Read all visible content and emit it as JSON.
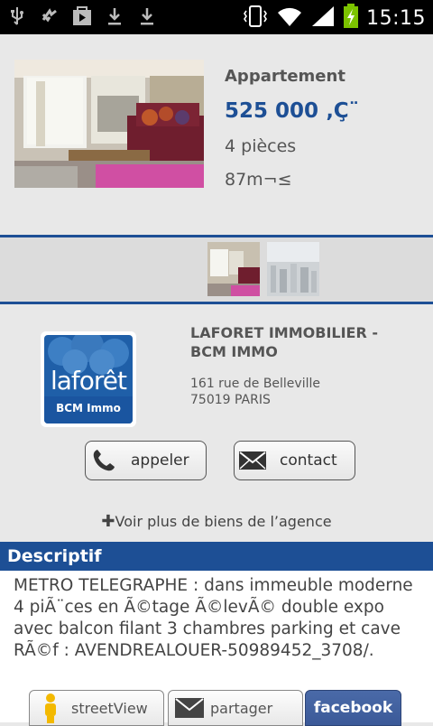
{
  "status_bar": {
    "time": "15:15",
    "left_icons": [
      "usb-icon",
      "sync-icon",
      "play-store-icon",
      "download-icon",
      "download-icon"
    ],
    "right_icons": [
      "vibrate-icon",
      "wifi-icon",
      "signal-icon",
      "battery-charging-icon"
    ]
  },
  "listing": {
    "type": "Appartement",
    "price": "525 000 ‚Ç¨",
    "rooms": "4 pièces",
    "area": "87m¬≤"
  },
  "thumbnails": [
    "living-room-photo",
    "city-view-photo"
  ],
  "agency": {
    "logo_word": "laforêt",
    "logo_sub": "BCM Immo",
    "name": "LAFORET IMMOBILIER - BCM IMMO",
    "address_line1": "161 rue de Belleville",
    "address_line2": "75019 PARIS",
    "call_label": "appeler",
    "contact_label": "contact",
    "more_link": "Voir plus de biens de l’agence"
  },
  "description": {
    "header": "Descriptif",
    "text": "METRO TELEGRAPHE :  dans immeuble moderne 4 piÃ¨ces en  Ã©tage Ã©levÃ© double expo  avec balcon filant  3 chambres parking et cave RÃ©f : AVENDREALOUER-50989452_3708/."
  },
  "bottom_bar": {
    "streetview_label": "streetView",
    "share_label": "partager",
    "facebook_label": "facebook"
  },
  "colors": {
    "accent": "#1d4f95",
    "background": "#e8e8e8",
    "facebook": "#3b5998"
  }
}
